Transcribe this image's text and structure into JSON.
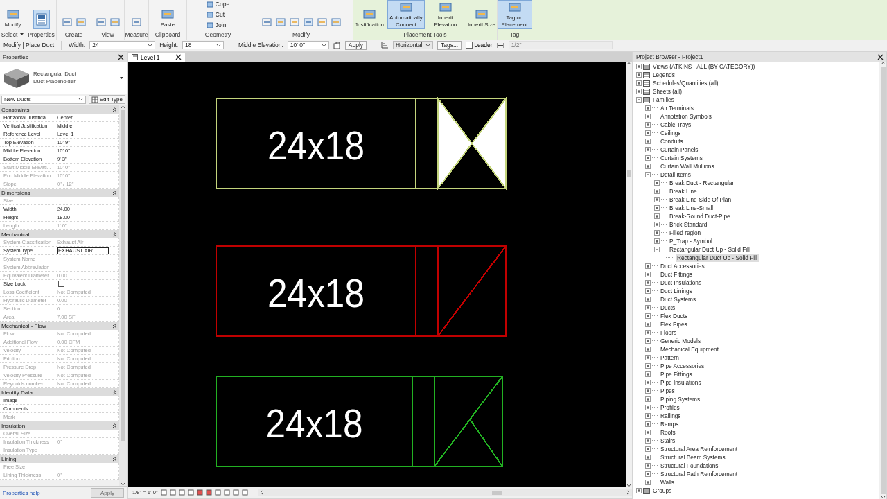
{
  "ribbon": {
    "panels": [
      {
        "label": "Select",
        "dropdown": true,
        "contextual": false,
        "tools": [
          {
            "label": "Modify",
            "kind": "large",
            "selected": false
          }
        ]
      },
      {
        "label": "Properties",
        "dropdown": false,
        "contextual": false,
        "tools": [
          {
            "kind": "icon",
            "selected": true
          }
        ]
      },
      {
        "label": "Create",
        "dropdown": false,
        "contextual": false
      },
      {
        "label": "View",
        "dropdown": false,
        "contextual": false
      },
      {
        "label": "Measure",
        "dropdown": false,
        "contextual": false
      },
      {
        "label": "Clipboard",
        "dropdown": false,
        "contextual": false,
        "tools": [
          {
            "label": "Paste",
            "kind": "large",
            "selected": false
          }
        ]
      },
      {
        "label": "Geometry",
        "dropdown": false,
        "contextual": false,
        "tools": [
          {
            "label": "Cope",
            "kind": "small",
            "selected": false
          },
          {
            "label": "Cut",
            "kind": "small",
            "selected": false
          },
          {
            "label": "Join",
            "kind": "small",
            "selected": false
          }
        ]
      },
      {
        "label": "Modify",
        "dropdown": false,
        "contextual": false
      },
      {
        "label": "Placement Tools",
        "dropdown": false,
        "contextual": true,
        "tools": [
          {
            "label": "Justification",
            "kind": "large",
            "selected": false
          },
          {
            "label": "Automatically Connect",
            "kind": "large",
            "selected": true
          },
          {
            "label": "Inherit Elevation",
            "kind": "large",
            "selected": false
          },
          {
            "label": "Inherit Size",
            "kind": "large",
            "selected": false
          }
        ]
      },
      {
        "label": "Tag",
        "dropdown": false,
        "contextual": true,
        "tools": [
          {
            "label": "Tag on Placement",
            "kind": "large",
            "selected": true
          }
        ]
      }
    ]
  },
  "options_bar": {
    "mode": "Modify | Place Duct",
    "fields": [
      {
        "label": "Width:",
        "value": "24"
      },
      {
        "label": "Height:",
        "value": "18"
      },
      {
        "label": "Middle Elevation:",
        "value": "10' 0\""
      }
    ],
    "apply": "Apply",
    "orientation": "Horizontal",
    "tags": "Tags...",
    "leader": {
      "label": "Leader",
      "checked": false
    },
    "leader_length": {
      "value": "1/2\"",
      "disabled": true
    }
  },
  "properties": {
    "title": "Properties",
    "type_name": "Rectangular Duct",
    "type_sub": "Duct Placeholder",
    "instance_filter": "New Ducts",
    "edit_type": "Edit Type",
    "groups": [
      {
        "name": "Constraints",
        "rows": [
          {
            "name": "Horizontal Justifica...",
            "value": "Center",
            "kind": "text",
            "disabled": false
          },
          {
            "name": "Vertical Justification",
            "value": "Middle",
            "kind": "text",
            "disabled": false
          },
          {
            "name": "Reference Level",
            "value": "Level 1",
            "kind": "text",
            "disabled": false
          },
          {
            "name": "Top Elevation",
            "value": "10' 9\"",
            "kind": "text",
            "disabled": false
          },
          {
            "name": "Middle Elevation",
            "value": "10' 0\"",
            "kind": "text",
            "disabled": false
          },
          {
            "name": "Bottom Elevation",
            "value": "9' 3\"",
            "kind": "text",
            "disabled": false
          },
          {
            "name": "Start Middle Elevati...",
            "value": "10' 0\"",
            "kind": "text",
            "disabled": true
          },
          {
            "name": "End Middle Elevation",
            "value": "10' 0\"",
            "kind": "text",
            "disabled": true
          },
          {
            "name": "Slope",
            "value": "0\" / 12\"",
            "kind": "text",
            "disabled": true
          }
        ]
      },
      {
        "name": "Dimensions",
        "rows": [
          {
            "name": "Size",
            "kind": "text",
            "disabled": true
          },
          {
            "name": "Width",
            "value": "24.00",
            "kind": "text",
            "disabled": false
          },
          {
            "name": "Height",
            "value": "18.00",
            "kind": "text",
            "disabled": false
          },
          {
            "name": "Length",
            "value": "1' 0\"",
            "kind": "text",
            "disabled": true
          }
        ]
      },
      {
        "name": "Mechanical",
        "rows": [
          {
            "name": "System Classification",
            "value": "Exhaust Air",
            "kind": "text",
            "disabled": true
          },
          {
            "name": "System Type",
            "value": "EXHAUST AIR",
            "kind": "field",
            "disabled": false
          },
          {
            "name": "System Name",
            "kind": "text",
            "disabled": true
          },
          {
            "name": "System Abbreviation",
            "kind": "text",
            "disabled": true
          },
          {
            "name": "Equivalent Diameter",
            "value": "0.00",
            "kind": "text",
            "disabled": true
          },
          {
            "name": "Size Lock",
            "kind": "checkbox",
            "checked": false,
            "disabled": false
          },
          {
            "name": "Loss Coefficient",
            "value": "Not Computed",
            "kind": "text",
            "disabled": true
          },
          {
            "name": "Hydraulic Diameter",
            "value": "0.00",
            "kind": "text",
            "disabled": true
          },
          {
            "name": "Section",
            "value": "0",
            "kind": "text",
            "disabled": true
          },
          {
            "name": "Area",
            "value": "7.00 SF",
            "kind": "text",
            "disabled": true
          }
        ]
      },
      {
        "name": "Mechanical - Flow",
        "rows": [
          {
            "name": "Flow",
            "value": "Not Computed",
            "kind": "text",
            "disabled": true
          },
          {
            "name": "Additional Flow",
            "value": "0.00 CFM",
            "kind": "text",
            "disabled": true
          },
          {
            "name": "Velocity",
            "value": "Not Computed",
            "kind": "text",
            "disabled": true
          },
          {
            "name": "Friction",
            "value": "Not Computed",
            "kind": "text",
            "disabled": true
          },
          {
            "name": "Pressure Drop",
            "value": "Not Computed",
            "kind": "text",
            "disabled": true
          },
          {
            "name": "Velocity Pressure",
            "value": "Not Computed",
            "kind": "text",
            "disabled": true
          },
          {
            "name": "Reynolds number",
            "value": "Not Computed",
            "kind": "text",
            "disabled": true
          }
        ]
      },
      {
        "name": "Identity Data",
        "rows": [
          {
            "name": "Image",
            "kind": "text",
            "disabled": false
          },
          {
            "name": "Comments",
            "kind": "text",
            "disabled": false
          },
          {
            "name": "Mark",
            "kind": "text",
            "disabled": true
          }
        ]
      },
      {
        "name": "Insulation",
        "rows": [
          {
            "name": "Overall Size",
            "kind": "text",
            "disabled": true
          },
          {
            "name": "Insulation Thickness",
            "value": "0\"",
            "kind": "text",
            "disabled": true
          },
          {
            "name": "Insulation Type",
            "kind": "text",
            "disabled": true
          }
        ]
      },
      {
        "name": "Lining",
        "rows": [
          {
            "name": "Free Size",
            "kind": "text",
            "disabled": true
          },
          {
            "name": "Lining Thickness",
            "value": "0\"",
            "kind": "text",
            "disabled": true
          }
        ]
      }
    ],
    "help": "Properties help",
    "apply": {
      "label": "Apply",
      "disabled": true
    }
  },
  "view": {
    "tab": {
      "label": "Level 1",
      "selected": true
    },
    "scale": "1/8\" = 1'-0\"",
    "ducts": [
      {
        "size": "24x18",
        "color": "#c3d47c",
        "kind": "bowtie"
      },
      {
        "size": "24x18",
        "color": "#c00000",
        "kind": "diagonal"
      },
      {
        "size": "24x18",
        "color": "#22b022",
        "kind": "angle"
      }
    ]
  },
  "browser": {
    "title": "Project Browser - Project1",
    "items": [
      {
        "label": "Views (ATKINS - ALL (BY CATEGORY))",
        "expanded": false,
        "selected": false
      },
      {
        "label": "Legends",
        "expanded": false,
        "selected": false
      },
      {
        "label": "Schedules/Quantities (all)",
        "expanded": false,
        "selected": false
      },
      {
        "label": "Sheets (all)",
        "expanded": false,
        "selected": false
      },
      {
        "label": "Families",
        "expanded": true,
        "selected": false,
        "children": [
          {
            "label": "Air Terminals",
            "expanded": false,
            "selected": false
          },
          {
            "label": "Annotation Symbols",
            "expanded": false,
            "selected": false
          },
          {
            "label": "Cable Trays",
            "expanded": false,
            "selected": false
          },
          {
            "label": "Ceilings",
            "expanded": false,
            "selected": false
          },
          {
            "label": "Conduits",
            "expanded": false,
            "selected": false
          },
          {
            "label": "Curtain Panels",
            "expanded": false,
            "selected": false
          },
          {
            "label": "Curtain Systems",
            "expanded": false,
            "selected": false
          },
          {
            "label": "Curtain Wall Mullions",
            "expanded": false,
            "selected": false
          },
          {
            "label": "Detail Items",
            "expanded": true,
            "selected": false,
            "children": [
              {
                "label": "Break Duct - Rectangular",
                "expanded": false,
                "selected": false
              },
              {
                "label": "Break Line",
                "expanded": false,
                "selected": false
              },
              {
                "label": "Break Line-Side Of Plan",
                "expanded": false,
                "selected": false
              },
              {
                "label": "Break Line-Small",
                "expanded": false,
                "selected": false
              },
              {
                "label": "Break-Round Duct-Pipe",
                "expanded": false,
                "selected": false
              },
              {
                "label": "Brick Standard",
                "expanded": false,
                "selected": false
              },
              {
                "label": "Filled region",
                "expanded": false,
                "selected": false
              },
              {
                "label": "P_Trap - Symbol",
                "expanded": false,
                "selected": false
              },
              {
                "label": "Rectangular Duct Up - Solid Fill",
                "expanded": true,
                "selected": false,
                "children": [
                  {
                    "label": "Rectangular Duct Up - Solid Fill",
                    "selected": true
                  }
                ]
              }
            ]
          },
          {
            "label": "Duct Accessories",
            "expanded": false,
            "selected": false
          },
          {
            "label": "Duct Fittings",
            "expanded": false,
            "selected": false
          },
          {
            "label": "Duct Insulations",
            "expanded": false,
            "selected": false
          },
          {
            "label": "Duct Linings",
            "expanded": false,
            "selected": false
          },
          {
            "label": "Duct Systems",
            "expanded": false,
            "selected": false
          },
          {
            "label": "Ducts",
            "expanded": false,
            "selected": false
          },
          {
            "label": "Flex Ducts",
            "expanded": false,
            "selected": false
          },
          {
            "label": "Flex Pipes",
            "expanded": false,
            "selected": false
          },
          {
            "label": "Floors",
            "expanded": false,
            "selected": false
          },
          {
            "label": "Generic Models",
            "expanded": false,
            "selected": false
          },
          {
            "label": "Mechanical Equipment",
            "expanded": false,
            "selected": false
          },
          {
            "label": "Pattern",
            "expanded": false,
            "selected": false
          },
          {
            "label": "Pipe Accessories",
            "expanded": false,
            "selected": false
          },
          {
            "label": "Pipe Fittings",
            "expanded": false,
            "selected": false
          },
          {
            "label": "Pipe Insulations",
            "expanded": false,
            "selected": false
          },
          {
            "label": "Pipes",
            "expanded": false,
            "selected": false
          },
          {
            "label": "Piping Systems",
            "expanded": false,
            "selected": false
          },
          {
            "label": "Profiles",
            "expanded": false,
            "selected": false
          },
          {
            "label": "Railings",
            "expanded": false,
            "selected": false
          },
          {
            "label": "Ramps",
            "expanded": false,
            "selected": false
          },
          {
            "label": "Roofs",
            "expanded": false,
            "selected": false
          },
          {
            "label": "Stairs",
            "expanded": false,
            "selected": false
          },
          {
            "label": "Structural Area Reinforcement",
            "expanded": false,
            "selected": false
          },
          {
            "label": "Structural Beam Systems",
            "expanded": false,
            "selected": false
          },
          {
            "label": "Structural Foundations",
            "expanded": false,
            "selected": false
          },
          {
            "label": "Structural Path Reinforcement",
            "expanded": false,
            "selected": false
          },
          {
            "label": "Walls",
            "expanded": false,
            "selected": false
          }
        ]
      },
      {
        "label": "Groups",
        "expanded": false,
        "selected": false
      }
    ]
  }
}
